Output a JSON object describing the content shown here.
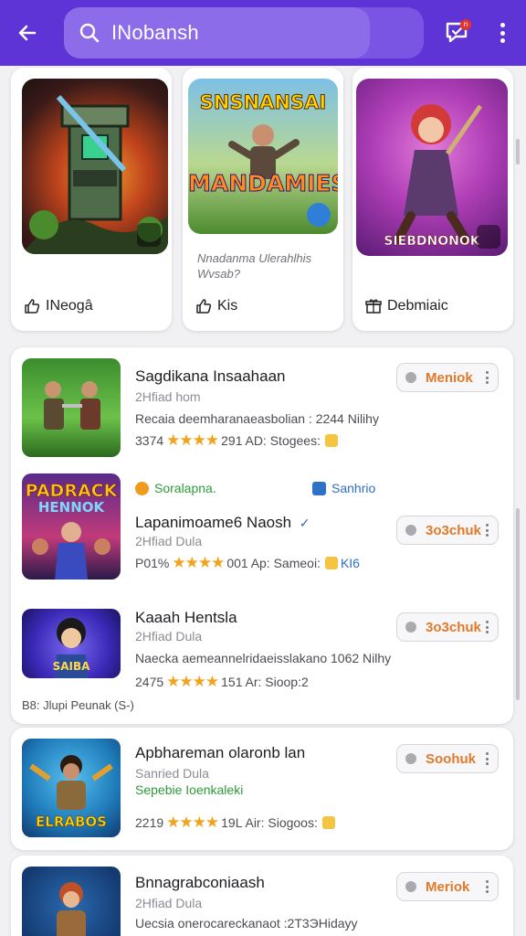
{
  "header": {
    "search_query": "INobansh",
    "chat_badge": "n"
  },
  "featured": [
    {
      "art_title": "",
      "description": "",
      "footer_label": "INeogâ"
    },
    {
      "art_title": "SNSNANSAI",
      "art_subtitle": "MANDAMIES",
      "description": "Nnadanma Ulerahlhis Wvsab?",
      "footer_label": "Kis"
    },
    {
      "art_title": "",
      "art_subtitle": "SIEBDNONOK",
      "description": "",
      "footer_label": "Debmiaic"
    }
  ],
  "apps": [
    {
      "title": "Sagdikana Insaahaan",
      "developer": "2Hfiad hom",
      "info": "Recaia deemharanaeasbolian : 2244 Nilihy",
      "rating_text": "3374",
      "stars": "★★★★",
      "count": "291",
      "tagline": "AD: Stogees:",
      "action": "Meniok"
    },
    {
      "tag_left": "Soralapna.",
      "tag_right": "Sanhrio",
      "art_title": "PADRACK",
      "art_subtitle": "HENNOK",
      "title": "Lapanimoame6 Naosh",
      "developer": "2Hfiad Dula",
      "rating_text": "P01%",
      "stars": "★★★★",
      "count": "001",
      "tagline": "Ap: Sameoi:",
      "extra": "KI6",
      "action": "3o3chuk"
    },
    {
      "art_title": "SAIBA",
      "title": "Kaaah Hentsla",
      "developer": "2Hfiad Dula",
      "info": "Naecka aemeannelridaeisslakano 1062 Nilhy",
      "rating_text": "2475",
      "stars": "★★★★",
      "count": "151",
      "tagline": "Ar: Sioop:2",
      "footer": "B8: Jlupi Peunak (S-)",
      "action": "3o3chuk"
    },
    {
      "art_title": "ELRABOS",
      "title": "Apbhareman olaronb lan",
      "developer": "Sanried Dula",
      "info": "Sepebie Ioenkaleki",
      "rating_text": "2219",
      "stars": "★★★★",
      "count": "19L",
      "tagline": "Air: Siogoos:",
      "action": "Soohuk"
    },
    {
      "title": "Bnnagrabconiaash",
      "developer": "2Hfiad Dula",
      "info": "Uecsia onerocareckanaot :2T3ЭHidayy",
      "action": "Meriok"
    }
  ]
}
